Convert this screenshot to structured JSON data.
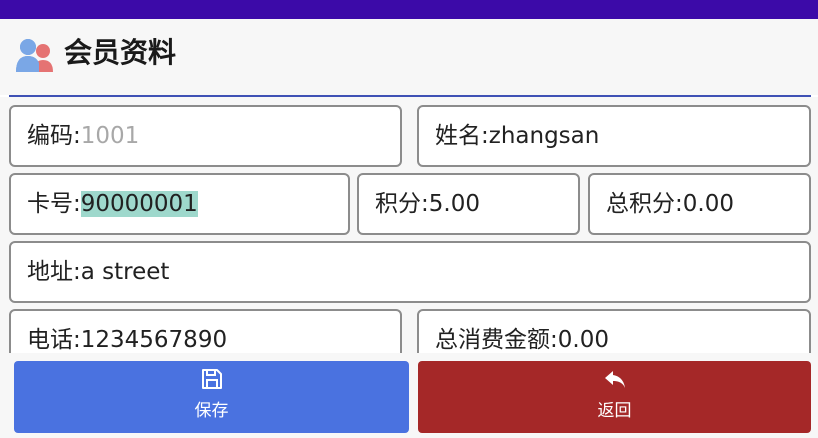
{
  "header": {
    "title": "会员资料",
    "icon": "member-group-icon"
  },
  "fields": {
    "code": {
      "label": "编码:",
      "value": "1001"
    },
    "name": {
      "label": "姓名:",
      "value": "zhangsan"
    },
    "card": {
      "label": "卡号:",
      "value": "90000001"
    },
    "points": {
      "label": "积分:",
      "value": "5.00"
    },
    "total_points": {
      "label": "总积分:",
      "value": "0.00"
    },
    "address": {
      "label": "地址:",
      "value": "a street"
    },
    "phone": {
      "label": "电话:",
      "value": "1234567890"
    },
    "total_spent": {
      "label": "总消费金额:",
      "value": "0.00"
    }
  },
  "buttons": {
    "save": {
      "label": "保存",
      "icon": "floppy-disk-icon",
      "color": "#4a72e0"
    },
    "back": {
      "label": "返回",
      "icon": "reply-arrow-icon",
      "color": "#a52828"
    }
  },
  "colors": {
    "status_bar": "#3c0aa8",
    "accent_rule": "#3f51b5",
    "selection": "#9ed8cc"
  }
}
